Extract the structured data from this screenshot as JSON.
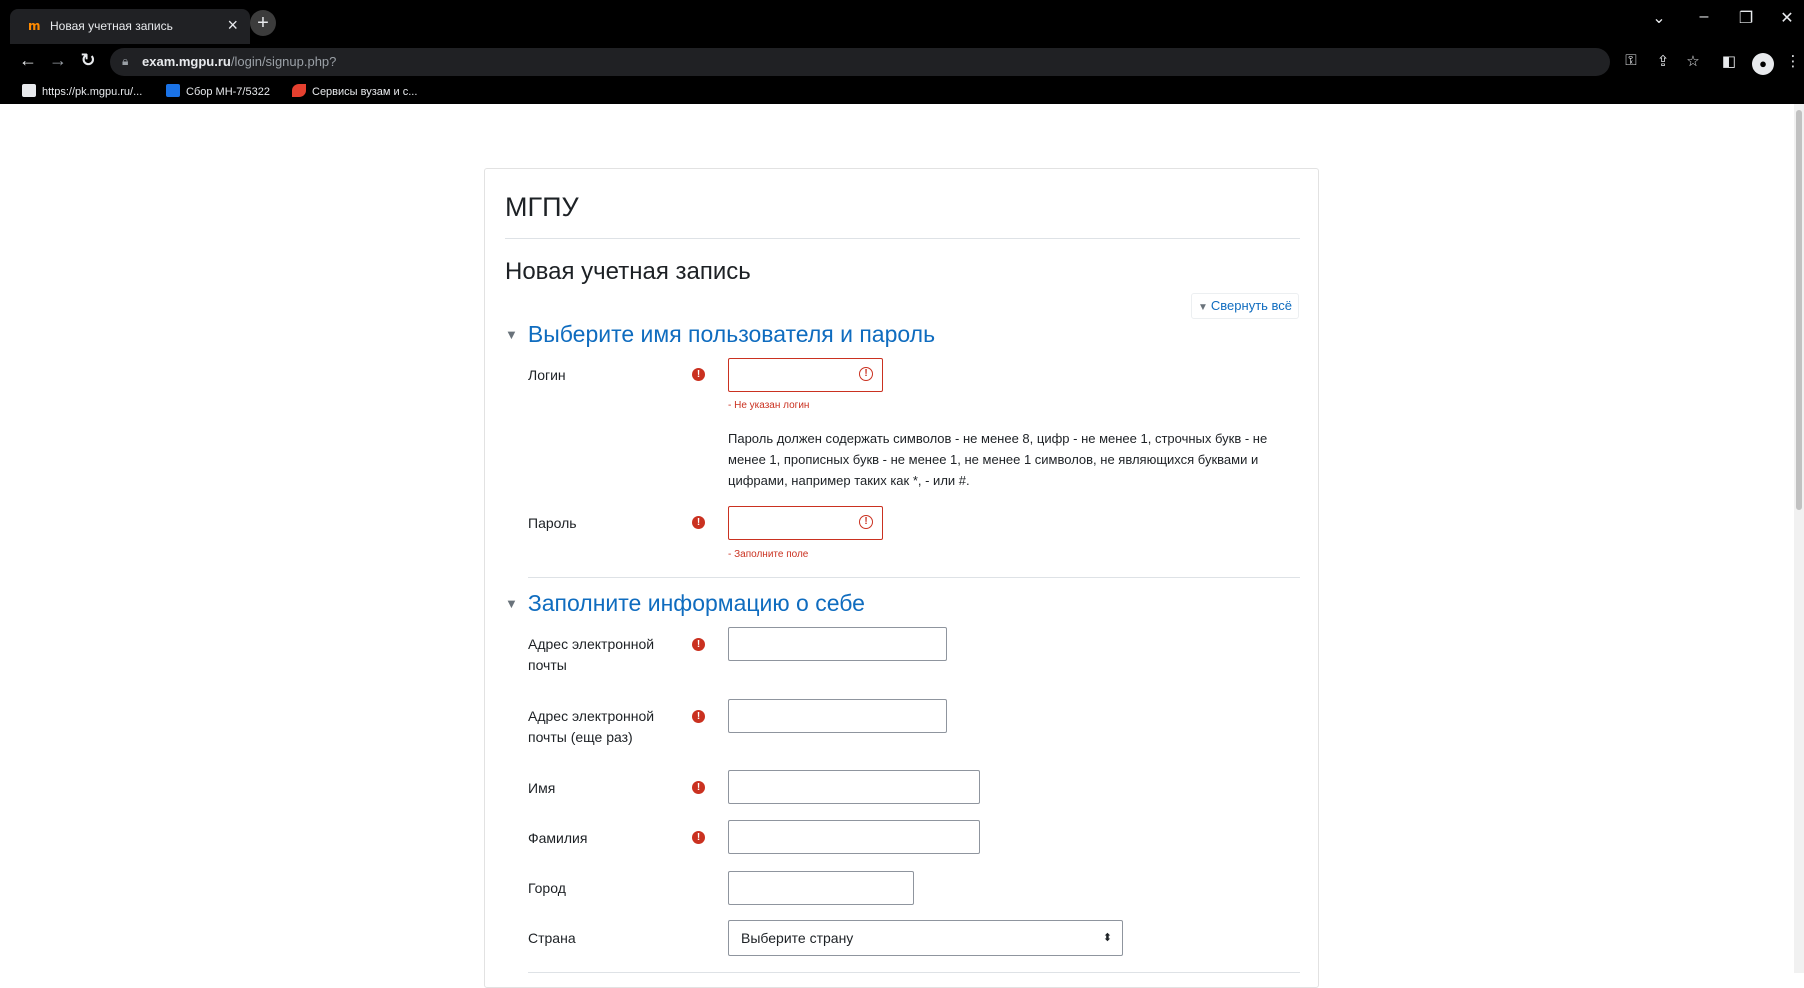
{
  "browser": {
    "tab_title": "Новая учетная запись",
    "tab_favicon": "m",
    "tab_close": "×",
    "new_tab": "+",
    "url_host": "exam.mgpu.ru",
    "url_path": "/login/signup.php?",
    "window_controls": [
      "⌄",
      "–",
      "❐",
      "✕"
    ],
    "bookmarks": [
      {
        "label": "https://pk.mgpu.ru/...",
        "color": "#e8eaed"
      },
      {
        "label": "Сбор МН-7/5322",
        "color": "#1a73e8"
      },
      {
        "label": "Сервисы вузам и с...",
        "color": "#e5402f"
      }
    ]
  },
  "page": {
    "site_name": "МГПУ",
    "title": "Новая учетная запись",
    "collapse_all": "Свернуть всё",
    "section1": {
      "heading": "Выберите имя пользователя и пароль",
      "username_label": "Логин",
      "username_error": "- Не указан логин",
      "password_hint": "Пароль должен содержать символов - не менее 8, цифр - не менее 1, строчных букв - не менее 1, прописных букв - не менее 1, не менее 1 символов, не являющихся буквами и цифрами, например таких как *, - или #.",
      "password_label": "Пароль",
      "password_error": "- Заполните поле"
    },
    "section2": {
      "heading": "Заполните информацию о себе",
      "email_label": "Адрес электронной почты",
      "email2_label": "Адрес электронной почты (еще раз)",
      "firstname_label": "Имя",
      "lastname_label": "Фамилия",
      "city_label": "Город",
      "country_label": "Страна",
      "country_value": "Выберите страну"
    },
    "required_mark": "!",
    "error_icon": "!"
  },
  "colors": {
    "accent": "#0f6cbf",
    "error": "#ca3120"
  }
}
